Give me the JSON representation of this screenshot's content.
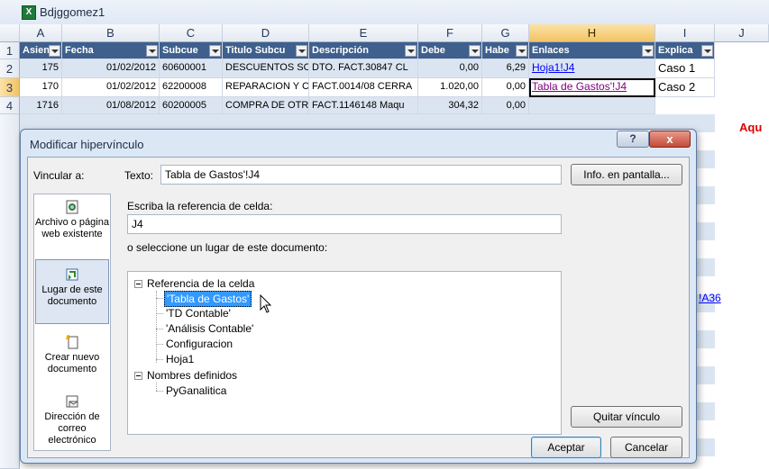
{
  "window": {
    "title": "Bdjggomez1",
    "app_icon": "excel-workbook-icon"
  },
  "columns": [
    "A",
    "B",
    "C",
    "D",
    "E",
    "F",
    "G",
    "H",
    "I",
    "J"
  ],
  "rows": [
    "1",
    "2",
    "3",
    "4"
  ],
  "table": {
    "headers": [
      "Asien",
      "Fecha",
      "Subcue",
      "Titulo Subcu",
      "Descripción",
      "Debe",
      "Habe",
      "Enlaces",
      "Explica"
    ],
    "data": [
      [
        "175",
        "01/02/2012",
        "60600001",
        "DESCUENTOS SO",
        "DTO. FACT.30847 CL",
        "0,00",
        "6,29",
        "Hoja1!J4",
        "Caso 1"
      ],
      [
        "170",
        "01/02/2012",
        "62200008",
        "REPARACION Y C",
        "FACT.0014/08 CERRA",
        "1.020,00",
        "0,00",
        "Tabla de Gastos'!J4",
        "Caso 2"
      ],
      [
        "1716",
        "01/08/2012",
        "60200005",
        "COMPRA DE OTRO",
        "FACT.1146148 Maqu",
        "304,32",
        "0,00",
        "",
        ""
      ]
    ]
  },
  "side_text": {
    "aqui": "Aqu",
    "link_fragment": "!A36"
  },
  "dialog": {
    "title": "Modificar hipervínculo",
    "vincular_label": "Vincular a:",
    "texto_label": "Texto:",
    "texto_value": "Tabla de Gastos'!J4",
    "info_button": "Info. en pantalla...",
    "ref_label": "Escriba la referencia de celda:",
    "ref_value": "J4",
    "place_label": "o seleccione un lugar de este documento:",
    "link_types": [
      {
        "label": "Archivo o página web existente",
        "icon": "web-page-icon"
      },
      {
        "label": "Lugar de este documento",
        "icon": "document-place-icon"
      },
      {
        "label": "Crear nuevo documento",
        "icon": "new-document-icon"
      },
      {
        "label": "Dirección de correo electrónico",
        "icon": "email-icon"
      }
    ],
    "tree": {
      "group1": "Referencia de la celda",
      "group1_items": [
        "'Tabla de Gastos'",
        "'TD Contable'",
        "'Análisis Contable'",
        "Configuracion",
        "Hoja1"
      ],
      "group2": "Nombres definidos",
      "group2_items": [
        "PyGanalitica"
      ]
    },
    "remove_button": "Quitar vínculo",
    "ok_button": "Aceptar",
    "cancel_button": "Cancelar",
    "help_button": "?",
    "close_button": "x"
  }
}
